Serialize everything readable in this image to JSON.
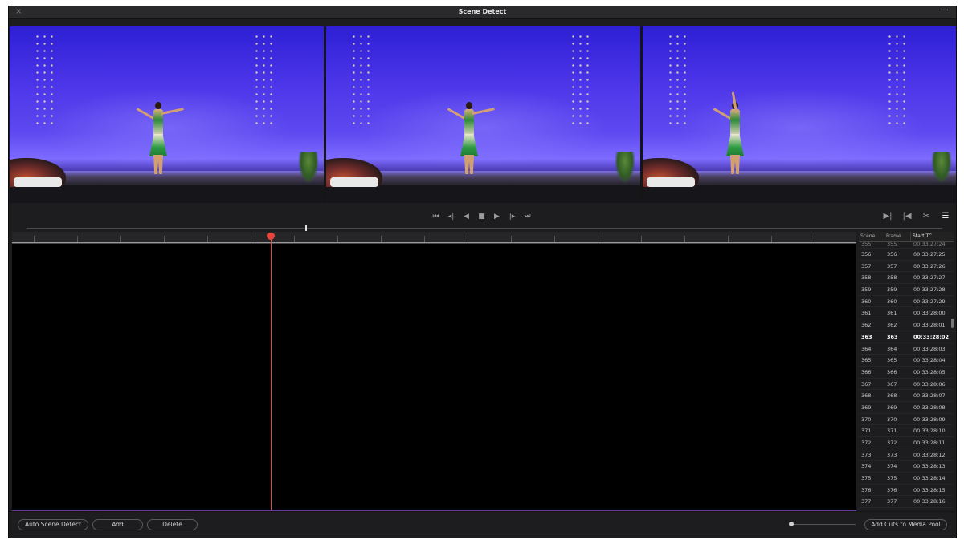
{
  "window": {
    "title": "Scene Detect",
    "close_glyph": "×",
    "more_glyph": "···"
  },
  "frames": [
    {
      "name": "previous-frame",
      "dancer_pose": "arm-extended"
    },
    {
      "name": "current-frame",
      "dancer_pose": "arm-extended"
    },
    {
      "name": "next-frame",
      "dancer_pose": "arm-raised"
    }
  ],
  "transport": {
    "buttons": [
      {
        "name": "go-to-start-icon",
        "glyph": "⏮"
      },
      {
        "name": "step-back-icon",
        "glyph": "◂|"
      },
      {
        "name": "play-reverse-icon",
        "glyph": "◀"
      },
      {
        "name": "stop-icon",
        "glyph": "■"
      },
      {
        "name": "play-icon",
        "glyph": "▶"
      },
      {
        "name": "step-forward-icon",
        "glyph": "|▸"
      },
      {
        "name": "go-to-end-icon",
        "glyph": "⏭"
      }
    ],
    "right_buttons": [
      {
        "name": "next-cut-icon",
        "glyph": "▶|"
      },
      {
        "name": "previous-cut-icon",
        "glyph": "|◀"
      },
      {
        "name": "cut-scissors-icon",
        "glyph": "✂"
      },
      {
        "name": "list-view-icon",
        "glyph": "☰"
      }
    ]
  },
  "scene_list": {
    "headers": {
      "scene": "Scene",
      "frame": "Frame",
      "start_tc": "Start TC"
    },
    "partial_top": {
      "scene": "355",
      "frame": "355",
      "start_tc": "00:33:27:24"
    },
    "selected_scene": "363",
    "rows": [
      {
        "scene": "356",
        "frame": "356",
        "start_tc": "00:33:27:25"
      },
      {
        "scene": "357",
        "frame": "357",
        "start_tc": "00:33:27:26"
      },
      {
        "scene": "358",
        "frame": "358",
        "start_tc": "00:33:27:27"
      },
      {
        "scene": "359",
        "frame": "359",
        "start_tc": "00:33:27:28"
      },
      {
        "scene": "360",
        "frame": "360",
        "start_tc": "00:33:27:29"
      },
      {
        "scene": "361",
        "frame": "361",
        "start_tc": "00:33:28:00"
      },
      {
        "scene": "362",
        "frame": "362",
        "start_tc": "00:33:28:01"
      },
      {
        "scene": "363",
        "frame": "363",
        "start_tc": "00:33:28:02"
      },
      {
        "scene": "364",
        "frame": "364",
        "start_tc": "00:33:28:03"
      },
      {
        "scene": "365",
        "frame": "365",
        "start_tc": "00:33:28:04"
      },
      {
        "scene": "366",
        "frame": "366",
        "start_tc": "00:33:28:05"
      },
      {
        "scene": "367",
        "frame": "367",
        "start_tc": "00:33:28:06"
      },
      {
        "scene": "368",
        "frame": "368",
        "start_tc": "00:33:28:07"
      },
      {
        "scene": "369",
        "frame": "369",
        "start_tc": "00:33:28:08"
      },
      {
        "scene": "370",
        "frame": "370",
        "start_tc": "00:33:28:09"
      },
      {
        "scene": "371",
        "frame": "371",
        "start_tc": "00:33:28:10"
      },
      {
        "scene": "372",
        "frame": "372",
        "start_tc": "00:33:28:11"
      },
      {
        "scene": "373",
        "frame": "373",
        "start_tc": "00:33:28:12"
      },
      {
        "scene": "374",
        "frame": "374",
        "start_tc": "00:33:28:13"
      },
      {
        "scene": "375",
        "frame": "375",
        "start_tc": "00:33:28:14"
      },
      {
        "scene": "376",
        "frame": "376",
        "start_tc": "00:33:28:15"
      },
      {
        "scene": "377",
        "frame": "377",
        "start_tc": "00:33:28:16"
      }
    ]
  },
  "bottom": {
    "auto_scene_detect": "Auto Scene Detect",
    "add": "Add",
    "delete": "Delete",
    "add_cuts": "Add Cuts to Media Pool"
  },
  "colors": {
    "accent_playhead": "#e8453c",
    "window_bg": "#1d1d1f",
    "timeline_bg": "#000000"
  }
}
